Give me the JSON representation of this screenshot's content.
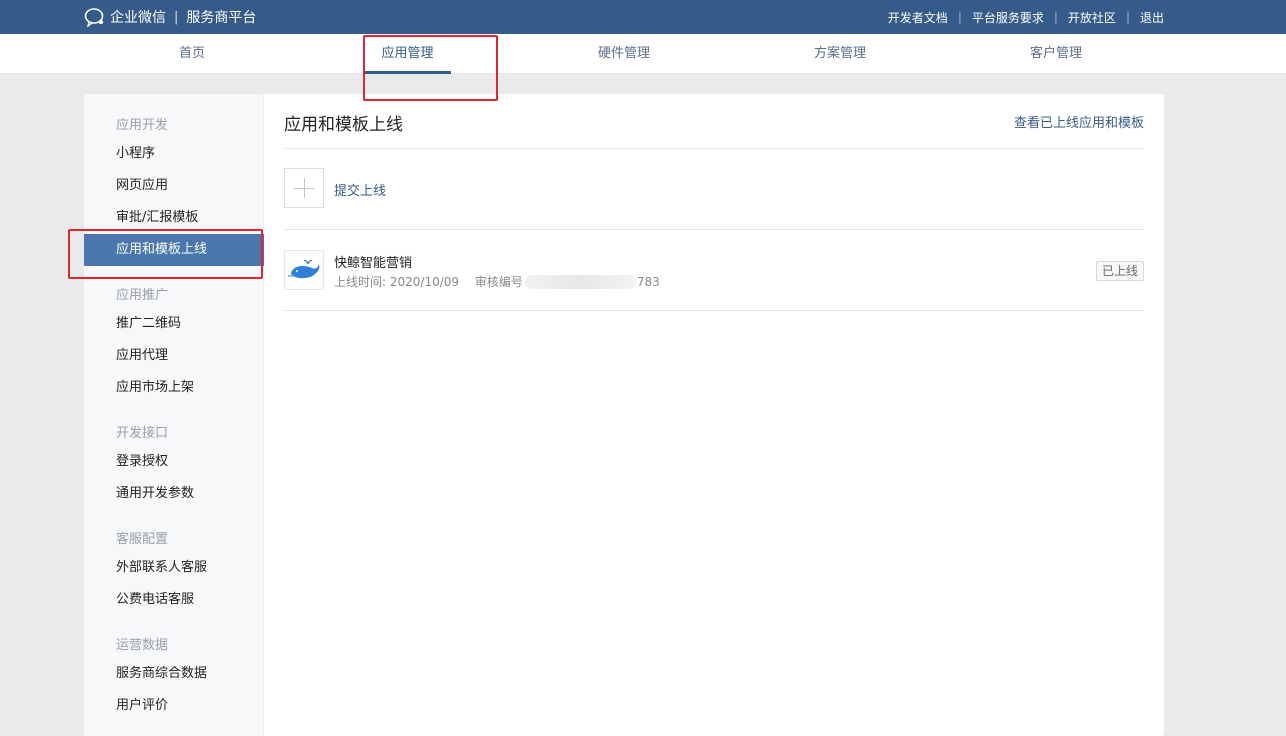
{
  "brand": {
    "name": "企业微信",
    "separator": "|",
    "subtitle": "服务商平台"
  },
  "top_links": [
    "开发者文档",
    "平台服务要求",
    "开放社区",
    "退出"
  ],
  "nav": {
    "items": [
      "首页",
      "应用管理",
      "硬件管理",
      "方案管理",
      "客户管理"
    ],
    "active": "应用管理"
  },
  "sidebar": {
    "groups": [
      {
        "title": "应用开发",
        "items": [
          "小程序",
          "网页应用",
          "审批/汇报模板",
          "应用和模板上线"
        ]
      },
      {
        "title": "应用推广",
        "items": [
          "推广二维码",
          "应用代理",
          "应用市场上架"
        ]
      },
      {
        "title": "开发接口",
        "items": [
          "登录授权",
          "通用开发参数"
        ]
      },
      {
        "title": "客服配置",
        "items": [
          "外部联系人客服",
          "公费电话客服"
        ]
      },
      {
        "title": "运营数据",
        "items": [
          "服务商综合数据",
          "用户评价"
        ]
      }
    ],
    "active": "应用和模板上线"
  },
  "main": {
    "title": "应用和模板上线",
    "view_link": "查看已上线应用和模板",
    "submit_label": "提交上线",
    "app": {
      "name": "快鲸智能营销",
      "date_label": "上线时间: 2020/10/09",
      "review_label": "审核编号",
      "review_suffix": "783",
      "status": "已上线"
    }
  },
  "colors": {
    "header": "#355b8a",
    "active_side": "#4a78ae",
    "highlight": "#e0272f"
  }
}
